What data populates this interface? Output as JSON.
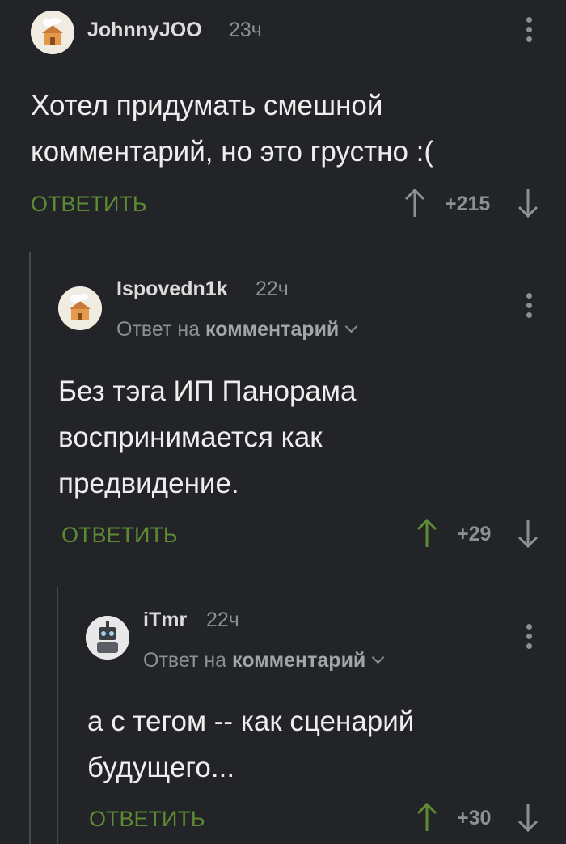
{
  "comments": [
    {
      "username": "JohnnyJOO",
      "time": "23ч",
      "text": "Хотел придумать смешной\nкомментарий, но это грустно :(",
      "reply_label": "ОТВЕТИТЬ",
      "score": "+215",
      "upvoted": false
    },
    {
      "username": "Ispovedn1k",
      "time": "22ч",
      "reply_to_prefix": "Ответ на",
      "reply_to_target": "комментарий",
      "text": "Без тэга ИП Панорама\nвоспринимается как\nпредвидение.",
      "reply_label": "ОТВЕТИТЬ",
      "score": "+29",
      "upvoted": true
    },
    {
      "username": "iTmr",
      "time": "22ч",
      "reply_to_prefix": "Ответ на",
      "reply_to_target": "комментарий",
      "text": "а с тегом -- как сценарий\nбудущего...",
      "reply_label": "ОТВЕТИТЬ",
      "score": "+30",
      "upvoted": true
    }
  ],
  "colors": {
    "background": "#222427",
    "accent_green": "#5d8b34",
    "muted": "#8d8f93"
  }
}
